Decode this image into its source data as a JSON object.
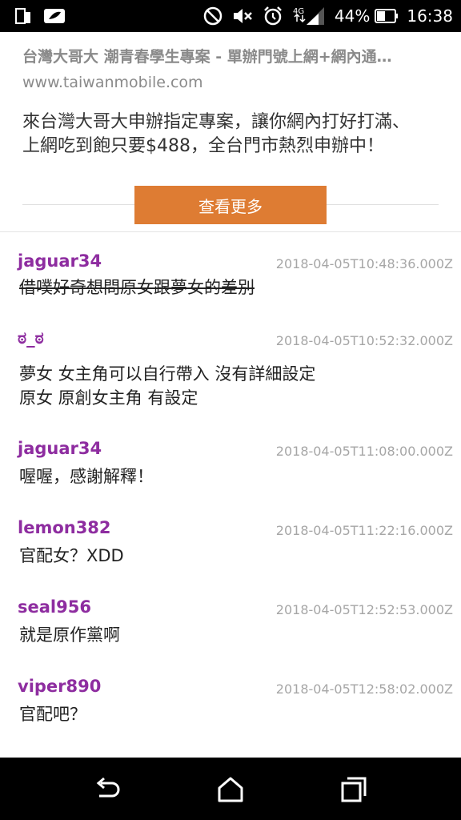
{
  "status_bar": {
    "battery_percent": "44%",
    "time": "16:38",
    "network_label": "4G",
    "icons": [
      "sim-icon",
      "leaf-icon",
      "do-not-disturb-icon",
      "mute-icon",
      "alarm-icon",
      "signal-icon",
      "battery-icon"
    ]
  },
  "ad": {
    "title": "台灣大哥大 潮青春學生專案 - 單辦門號上網+網內通…",
    "url": "www.taiwanmobile.com",
    "description": "來台灣大哥大申辦指定專案，讓你網內打好打滿、上網吃到飽只要$488，全台門市熱烈申辦中！",
    "button_label": "查看更多",
    "button_color": "#de7c33"
  },
  "comments": [
    {
      "user": "jaguar34",
      "time": "2018-04-05T10:48:36.000Z",
      "lines": [
        "借噗好奇想問原女跟夢女的差別"
      ],
      "strikethrough": true
    },
    {
      "user": "ಠ_ಠ",
      "time": "2018-04-05T10:52:32.000Z",
      "lines": [
        "夢女 女主角可以自行帶入 沒有詳細設定",
        "原女 原創女主角 有設定"
      ],
      "strikethrough": false
    },
    {
      "user": "jaguar34",
      "time": "2018-04-05T11:08:00.000Z",
      "lines": [
        "喔喔，感謝解釋！"
      ],
      "strikethrough": false
    },
    {
      "user": "lemon382",
      "time": "2018-04-05T11:22:16.000Z",
      "lines": [
        "官配女？XDD"
      ],
      "strikethrough": false
    },
    {
      "user": "seal956",
      "time": "2018-04-05T12:52:53.000Z",
      "lines": [
        "就是原作黨啊"
      ],
      "strikethrough": false
    },
    {
      "user": "viper890",
      "time": "2018-04-05T12:58:02.000Z",
      "lines": [
        "官配吧？"
      ],
      "strikethrough": false
    }
  ],
  "colors": {
    "username": "#8e2da0",
    "timestamp": "#a6a6a6"
  },
  "nav_bar": {
    "icons": [
      "back-icon",
      "home-icon",
      "recents-icon"
    ]
  }
}
